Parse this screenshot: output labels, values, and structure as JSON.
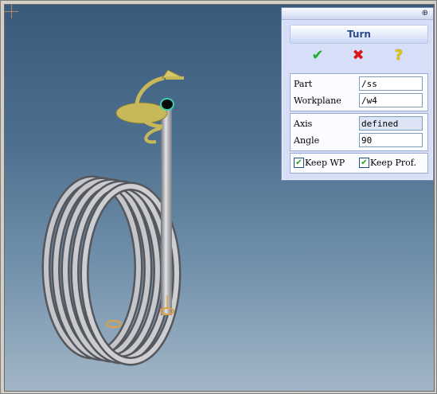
{
  "panel": {
    "title": "Turn",
    "pin_glyph": "⊕",
    "actions": [
      {
        "name": "ok",
        "glyph": "✔",
        "icon": "green-check-icon",
        "color": "#1fae2f"
      },
      {
        "name": "cancel",
        "glyph": "✖",
        "icon": "red-x-icon",
        "color": "#d81818"
      },
      {
        "name": "help",
        "glyph": "?",
        "icon": "help-question-icon",
        "color": "#e5c100"
      }
    ],
    "fields": {
      "part_label": "Part",
      "part_value": "/ss",
      "workplane_label": "Workplane",
      "workplane_value": "/w4",
      "axis_label": "Axis",
      "axis_value": "defined",
      "angle_label": "Angle",
      "angle_value": "90"
    },
    "options": {
      "keep_wp_label": "Keep WP",
      "keep_wp_checked": true,
      "keep_prof_label": "Keep Prof.",
      "keep_prof_checked": true
    }
  },
  "colors": {
    "viewport_top": "#3a5a7c",
    "viewport_bottom": "#a3b6c7",
    "pipe": "#b4b6bc",
    "manipulator": "#c7b85a"
  }
}
